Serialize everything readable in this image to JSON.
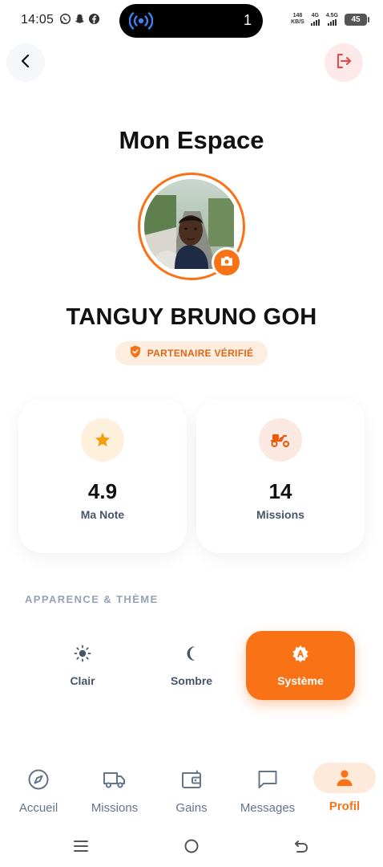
{
  "status_bar": {
    "time": "14:05",
    "island_count": "1",
    "net_speed_value": "148",
    "net_speed_unit": "KB/S",
    "signal1_label": "4G",
    "signal2_label": "4.5G",
    "battery": "45"
  },
  "header": {
    "title": "Mon Espace"
  },
  "profile": {
    "name": "TANGUY BRUNO GOH",
    "badge": "PARTENAIRE VÉRIFIÉ"
  },
  "stats": [
    {
      "value": "4.9",
      "label": "Ma Note",
      "icon": "star-icon"
    },
    {
      "value": "14",
      "label": "Missions",
      "icon": "scooter-icon"
    }
  ],
  "appearance": {
    "section_label": "APPARENCE & THÈME",
    "options": [
      {
        "label": "Clair",
        "icon": "sun-icon",
        "selected": false
      },
      {
        "label": "Sombre",
        "icon": "moon-icon",
        "selected": false
      },
      {
        "label": "Système",
        "icon": "auto-theme-icon",
        "selected": true
      }
    ]
  },
  "bottom_nav": {
    "items": [
      {
        "label": "Accueil",
        "icon": "compass-icon",
        "active": false
      },
      {
        "label": "Missions",
        "icon": "truck-icon",
        "active": false
      },
      {
        "label": "Gains",
        "icon": "wallet-icon",
        "active": false
      },
      {
        "label": "Messages",
        "icon": "chat-icon",
        "active": false
      },
      {
        "label": "Profil",
        "icon": "person-icon",
        "active": true
      }
    ]
  },
  "colors": {
    "accent": "#f97316",
    "logout_bg": "#fde9e9",
    "logout_icon": "#ef4444",
    "text_primary": "#111111",
    "text_muted": "#475569",
    "section_label": "#94a3b8"
  }
}
